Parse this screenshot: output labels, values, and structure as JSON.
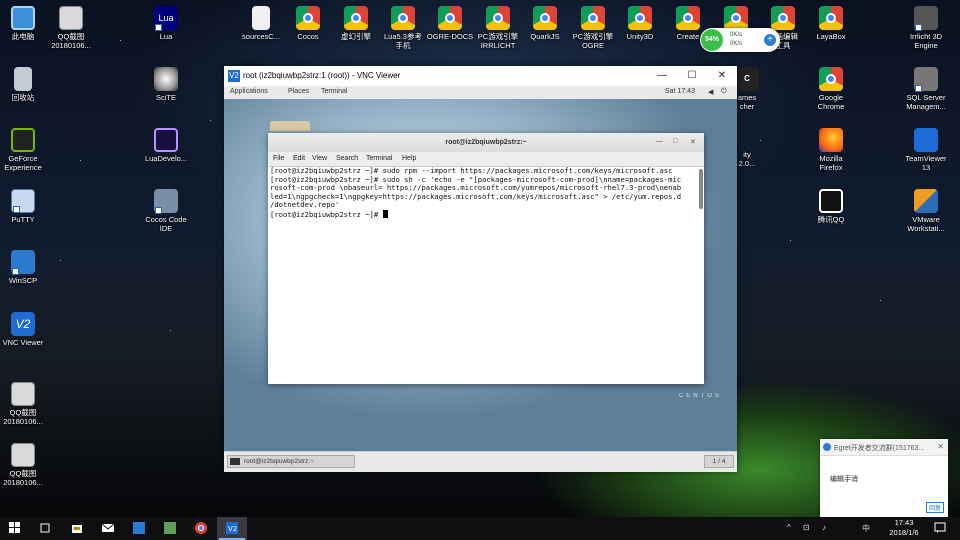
{
  "desktop": {
    "left_column": [
      {
        "label": "此电脑",
        "icon": "monitor-icon"
      },
      {
        "label": "回收站",
        "icon": "recycle-bin-icon"
      },
      {
        "label": "GeForce\nExperience",
        "icon": "geforce-icon"
      },
      {
        "label": "PuTTY",
        "icon": "putty-icon"
      },
      {
        "label": "WinSCP",
        "icon": "winscp-icon"
      },
      {
        "label": "VNC Viewer",
        "icon": "vnc-viewer-icon"
      },
      {
        "label": "QQ截图\n20180106...",
        "icon": "image-file-icon"
      },
      {
        "label": "QQ截图\n20180106...",
        "icon": "image-file-icon"
      }
    ],
    "top_row": [
      {
        "label": "QQ截图\n20180106...",
        "icon": "image-file-icon"
      },
      {
        "label": "Lua",
        "icon": "lua-icon"
      },
      {
        "label": "sourcesC...",
        "icon": "text-file-icon"
      },
      {
        "label": "Cocos",
        "icon": "chrome-icon"
      },
      {
        "label": "虚幻引擎",
        "icon": "chrome-icon"
      },
      {
        "label": "Lua5.3参考\n手机",
        "icon": "chrome-icon"
      },
      {
        "label": "OGRE-DOCS",
        "icon": "chrome-icon"
      },
      {
        "label": "PC游戏引擎\nIRRLICHT",
        "icon": "chrome-icon"
      },
      {
        "label": "QuarkJS",
        "icon": "chrome-icon"
      },
      {
        "label": "PC游戏引擎\nOGRE",
        "icon": "chrome-icon"
      },
      {
        "label": "Unity3D",
        "icon": "chrome-icon"
      },
      {
        "label": "Create",
        "icon": "chrome-icon"
      },
      {
        "label": "",
        "icon": "chrome-icon"
      },
      {
        "label": "动画编辑\n工具",
        "icon": "chrome-icon"
      },
      {
        "label": "LayaBox",
        "icon": "chrome-icon"
      },
      {
        "label": "Irrlicht 3D\nEngine",
        "icon": "irrlicht-icon"
      }
    ],
    "column3": [
      {
        "label": "SciTE",
        "icon": "scite-icon"
      },
      {
        "label": "LuaDevelo...",
        "icon": "luadev-icon"
      },
      {
        "label": "Cocos Code\nIDE",
        "icon": "cocos-ide-icon"
      }
    ],
    "right_columns": [
      {
        "label": "ames\ncher",
        "icon": "game-launcher-icon"
      },
      {
        "label": "ity\n2.0...",
        "icon": "partial-app-icon"
      },
      {
        "label": "Google\nChrome",
        "icon": "chrome-icon"
      },
      {
        "label": "Mozilla\nFirefox",
        "icon": "firefox-icon"
      },
      {
        "label": "腾讯QQ",
        "icon": "qq-penguin-icon"
      },
      {
        "label": "SQL Server\nManagem...",
        "icon": "sql-server-icon"
      },
      {
        "label": "TeamViewer\n13",
        "icon": "teamviewer-icon"
      },
      {
        "label": "VMware\nWorkstati...",
        "icon": "vmware-icon"
      }
    ]
  },
  "speed_widget": {
    "percent": "54%",
    "up": "0K/s",
    "down": "0K/s",
    "plus": "+"
  },
  "vnc": {
    "title": "root (iz2bqiuwbp2strz:1 (root)) - VNC Viewer",
    "logo": "V2",
    "minimize": "—",
    "maximize": "☐",
    "close": "✕",
    "gnome_top": {
      "applications": "Applications",
      "places": "Places",
      "terminal": "Terminal",
      "clock": "Sat 17:43"
    },
    "centos_mark": "CENTOS",
    "taskbar_item": "root@iz2bqiuwbp2strz:~",
    "pager": "1 / 4"
  },
  "terminal": {
    "title": "root@iz2bqiuwbp2strz:~",
    "menu": [
      "File",
      "Edit",
      "View",
      "Search",
      "Terminal",
      "Help"
    ],
    "lines": [
      "[root@iz2bqiuwbp2strz ~]# sudo rpm --import https://packages.microsoft.com/keys/microsoft.asc",
      "[root@iz2bqiuwbp2strz ~]# sudo sh -c 'echo -e \"[packages-microsoft-com-prod]\\nname=packages-mic",
      "rosoft-com-prod \\nbaseurl= https://packages.microsoft.com/yumrepos/microsoft-rhel7.3-prod\\nenab",
      "led=1\\ngpgcheck=1\\ngpgkey=https://packages.microsoft.com/keys/microsoft.asc\" > /etc/yum.repos.d",
      "/dotnetdev.repo'",
      "[root@iz2bqiuwbp2strz ~]# "
    ]
  },
  "notification": {
    "title": "Egret开发者交流群(151763...",
    "body": "编辑手消",
    "close": "✕",
    "action": "回复"
  },
  "taskbar": {
    "tray_icons": [
      "^",
      "⊡",
      "♪",
      "中"
    ],
    "time": "17:43",
    "date": "2018/1/6"
  },
  "colors": {
    "taskbar": "#0f0f12",
    "accent": "#7fb2ff",
    "chrome_blue": "#4285f4"
  }
}
